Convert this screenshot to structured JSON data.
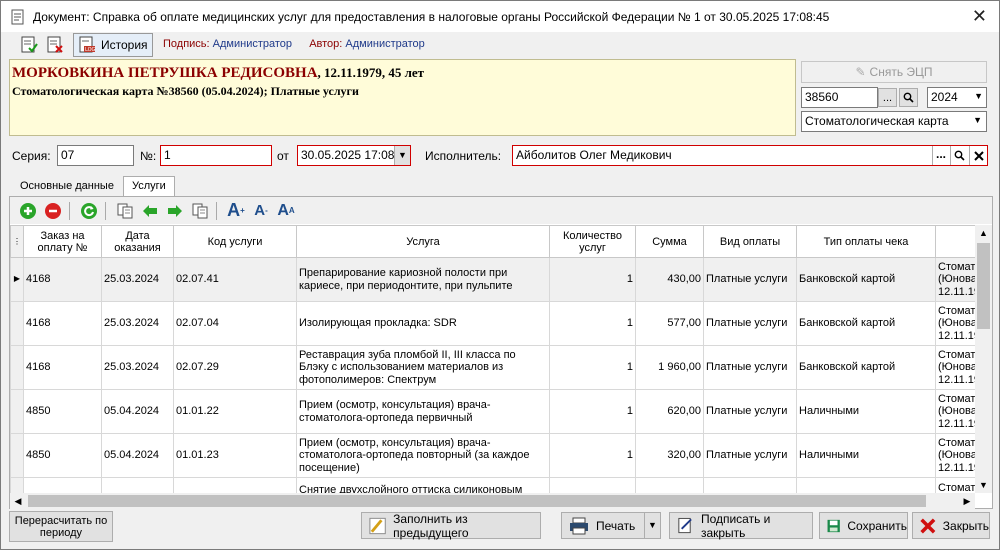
{
  "window": {
    "title": "Документ: Справка об оплате медицинских услуг для предоставления в налоговые органы Российской Федерации № 1 от 30.05.2025 17:08:45",
    "close": "✕"
  },
  "toolbar": {
    "history_label": "История",
    "sign_label": "Подпись:",
    "sign_value": "Администратор",
    "author_label": "Автор:",
    "author_value": "Администратор"
  },
  "patient": {
    "name": "МОРКОВКИНА ПЕТРУШКА РЕДИСОВНА",
    "details": ", 12.11.1979, 45 лет",
    "card": "Стоматологическая карта №38560 (05.04.2024); Платные услуги"
  },
  "right_panel": {
    "remove_ecp": "Снять ЭЦП",
    "card_number": "38560",
    "year": "2024",
    "card_type": "Стоматологическая карта",
    "dots": "...",
    "search": "🔍"
  },
  "form": {
    "series_label": "Серия:",
    "series_value": "07",
    "number_label": "№:",
    "number_value": "1",
    "from_label": "от",
    "date_value": "30.05.2025 17:08",
    "executor_label": "Исполнитель:",
    "executor_value": "Айболитов Олег Медикович"
  },
  "tabs": [
    {
      "label": "Основные данные"
    },
    {
      "label": "Услуги"
    }
  ],
  "grid": {
    "headers": [
      "Заказ на оплату №",
      "Дата оказания",
      "Код услуги",
      "Услуга",
      "Количество услуг",
      "Сумма",
      "Вид оплаты",
      "Тип оплаты чека",
      ""
    ],
    "rows": [
      [
        "4168",
        "25.03.2024",
        "02.07.41",
        "Препарирование кариозной полости при кариесе, при периодонтите, при пульпите",
        "1",
        "430,00",
        "Платные услуги",
        "Банковской картой",
        "Стомат. (Юнова 12.11.19"
      ],
      [
        "4168",
        "25.03.2024",
        "02.07.04",
        "Изолирующая прокладка: SDR",
        "1",
        "577,00",
        "Платные услуги",
        "Банковской картой",
        "Стомат. (Юнова 12.11.19"
      ],
      [
        "4168",
        "25.03.2024",
        "02.07.29",
        "Реставрация зуба пломбой II, III класса по Блэку с использованием материалов из фотополимеров: Спектрум",
        "1",
        "1 960,00",
        "Платные услуги",
        "Банковской картой",
        "Стомат. (Юнова 12.11.19"
      ],
      [
        "4850",
        "05.04.2024",
        "01.01.22",
        "Прием (осмотр, консультация) врача-стоматолога-ортопеда первичный",
        "1",
        "620,00",
        "Платные услуги",
        "Наличными",
        "Стомат. (Юнова 12.11.19"
      ],
      [
        "4850",
        "05.04.2024",
        "01.01.23",
        "Прием (осмотр, консультация) врача-стоматолога-ортопеда повторный (за каждое посещение)",
        "1",
        "320,00",
        "Платные услуги",
        "Наличными",
        "Стомат. (Юнова 12.11.19"
      ],
      [
        "",
        "",
        "",
        "Снятие двухслойного оттиска силиконовым",
        "",
        "",
        "",
        "",
        "Стомат."
      ]
    ]
  },
  "bottom": {
    "recalc": "Перерасчитать по периоду",
    "fill": "Заполнить из предыдущего",
    "print": "Печать",
    "sign_close": "Подписать и закрыть",
    "save": "Сохранить",
    "close": "Закрыть"
  }
}
